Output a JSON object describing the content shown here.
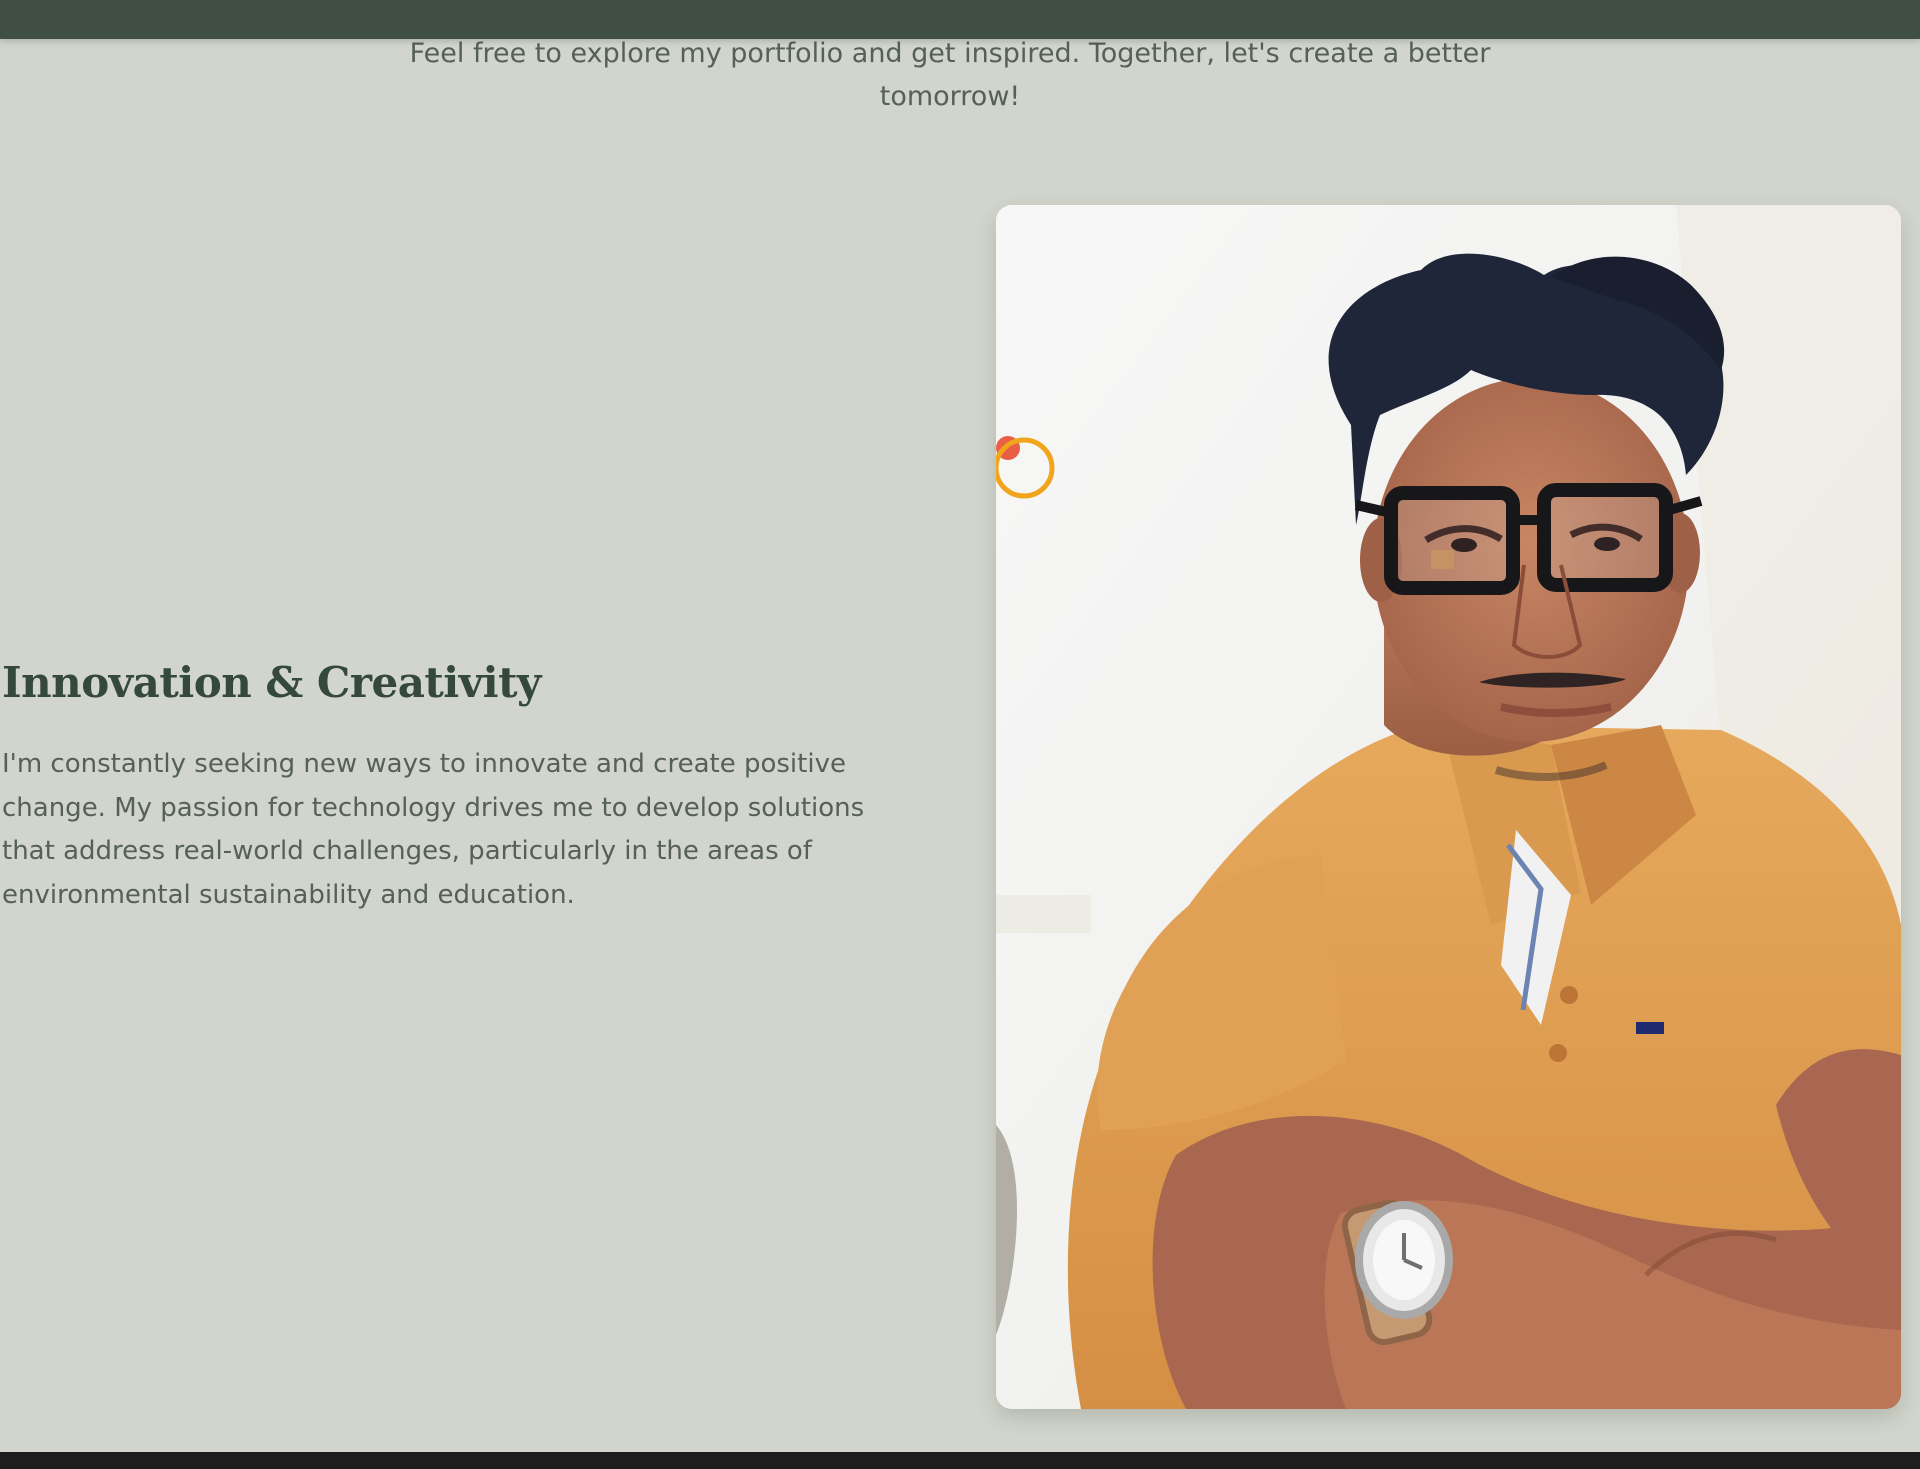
{
  "intro": {
    "text": "Feel free to explore my portfolio and get inspired. Together, let's create a better tomorrow!"
  },
  "feature": {
    "title": "Innovation & Creativity",
    "body": "I'm constantly seeking new ways to innovate and create positive change. My passion for technology drives me to develop solutions that address real-world challenges, particularly in the areas of environmental sustainability and education."
  },
  "colors": {
    "page_background": "#d1d5cb",
    "header_bar": "#3f4f43",
    "heading": "#34483b",
    "body_text": "#56605a",
    "footer_bar": "#1d1e1d"
  }
}
